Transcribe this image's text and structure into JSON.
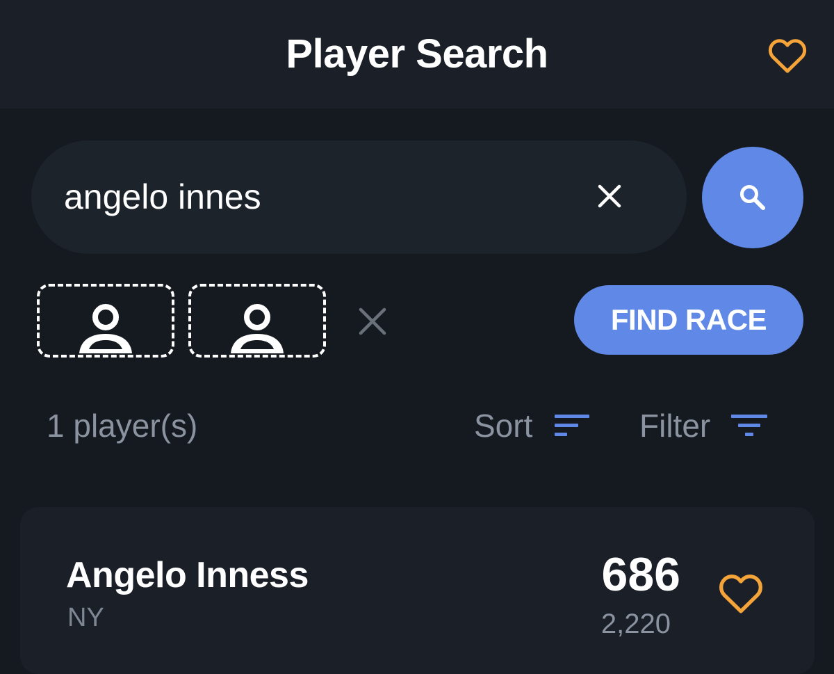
{
  "header": {
    "title": "Player Search",
    "favorite_icon": "heart-outline-icon"
  },
  "search": {
    "value": "angelo innes",
    "clear_icon": "close-icon",
    "submit_icon": "search-icon"
  },
  "race": {
    "slots": [
      {
        "icon": "person-placeholder-icon"
      },
      {
        "icon": "person-placeholder-icon"
      }
    ],
    "clear_icon": "close-icon",
    "find_race_label": "FIND RACE"
  },
  "results": {
    "count_label": "1 player(s)",
    "sort_label": "Sort",
    "sort_icon": "sort-icon",
    "filter_label": "Filter",
    "filter_icon": "filter-icon"
  },
  "players": [
    {
      "name": "Angelo Inness",
      "state": "NY",
      "score": "686",
      "sub_score": "2,220",
      "favorite_icon": "heart-outline-icon"
    }
  ],
  "colors": {
    "background": "#151a21",
    "header": "#1b2028",
    "accent_blue": "#6088e6",
    "favorite_orange": "#f5a43a",
    "muted_text": "#8b93a0"
  }
}
